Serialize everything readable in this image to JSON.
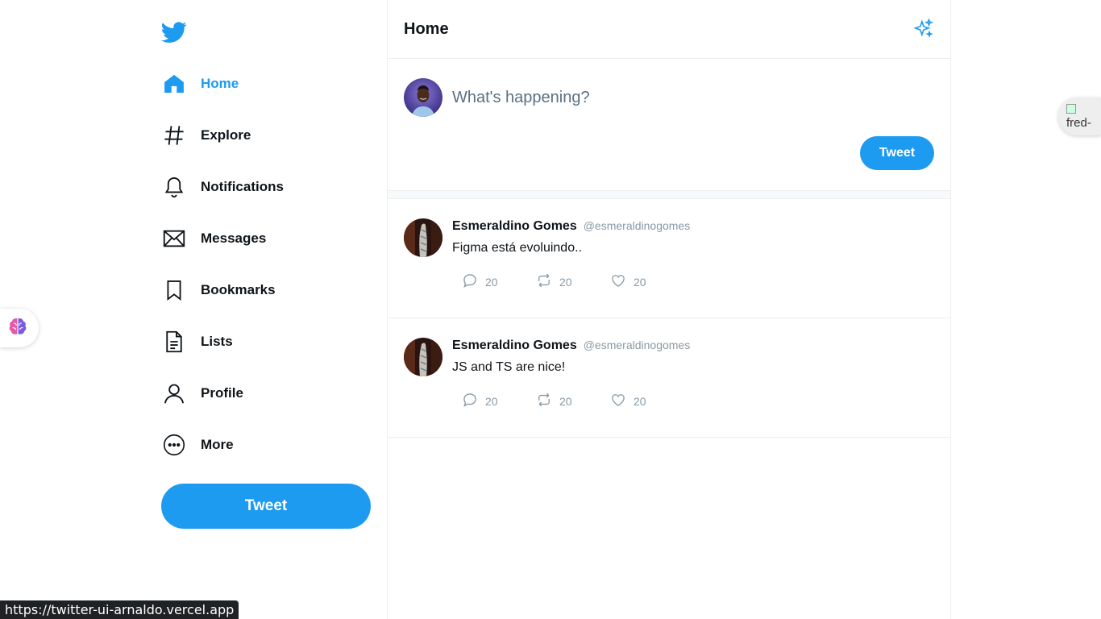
{
  "sidebar": {
    "logo": "twitter-bird-icon",
    "items": [
      {
        "label": "Home",
        "icon": "home-icon",
        "active": true
      },
      {
        "label": "Explore",
        "icon": "hashtag-icon"
      },
      {
        "label": "Notifications",
        "icon": "bell-icon"
      },
      {
        "label": "Messages",
        "icon": "envelope-icon"
      },
      {
        "label": "Bookmarks",
        "icon": "bookmark-icon"
      },
      {
        "label": "Lists",
        "icon": "list-document-icon"
      },
      {
        "label": "Profile",
        "icon": "user-icon"
      },
      {
        "label": "More",
        "icon": "more-dots-icon"
      }
    ],
    "tweet_button": "Tweet"
  },
  "main": {
    "title": "Home",
    "composer": {
      "placeholder": "What's happening?",
      "tweet_button": "Tweet"
    },
    "tweets": [
      {
        "name": "Esmeraldino Gomes",
        "handle": "@esmeraldinogomes",
        "text": "Figma está evoluindo..",
        "replies": "20",
        "retweets": "20",
        "likes": "20"
      },
      {
        "name": "Esmeraldino Gomes",
        "handle": "@esmeraldinogomes",
        "text": "JS and TS are nice!",
        "replies": "20",
        "retweets": "20",
        "likes": "20"
      }
    ]
  },
  "overlay": {
    "side_image_alt": "fred-",
    "status_url": "https://twitter-ui-arnaldo.vercel.app"
  },
  "colors": {
    "accent": "#1d9bf0",
    "text": "#0f1419",
    "muted": "#8899a6",
    "border": "#ebeef0"
  }
}
